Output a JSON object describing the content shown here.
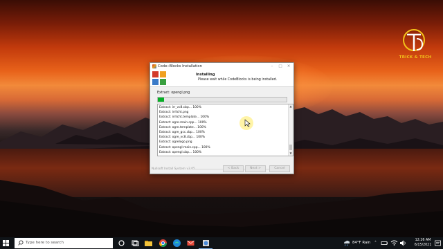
{
  "window": {
    "title": "Code::Blocks Installation",
    "header_title": "Installing",
    "header_subtitle": "Please wait while CodeBlocks is being installed.",
    "current_file": "Extract: opengl.png",
    "progress": 0.05,
    "log_lines": [
      "Extract: irr_vc8.cbp... 100%",
      "Extract: irrlicht.png",
      "Extract: irrlicht.template... 100%",
      "Extract: ogre-main.cpp... 100%",
      "Extract: ogre.template... 100%",
      "Extract: ogre_gcc.cbp... 100%",
      "Extract: ogre_vc8.cbp... 100%",
      "Extract: ogrelogo.png",
      "Extract: opengl-main.cpp... 100%",
      "Extract: opengl.cbp... 100%"
    ],
    "footer_text": "Nullsoft Install System v3.05",
    "back_label": "< Back",
    "next_label": "Next >",
    "cancel_label": "Cancel"
  },
  "watermark": {
    "text": "TRICK & TECH"
  },
  "taskbar": {
    "search_placeholder": "Type here to search",
    "weather": "84°F  Rain",
    "time": "12:26 AM",
    "date": "6/15/2021"
  },
  "icons": {
    "start": "windows-start-icon",
    "search": "search-icon",
    "task_view": "task-view-icon",
    "apps": [
      "cortana-icon",
      "task-view-icon",
      "file-explorer-icon",
      "chrome-icon",
      "edge-icon",
      "mail-icon",
      "codeblocks-installer-icon"
    ],
    "tray": [
      "network-icon",
      "volume-icon",
      "notification-icon"
    ]
  },
  "colors": {
    "progress_fill": "#06b025",
    "taskbar_bg": "#101418",
    "accent": "#7fb1e6"
  }
}
